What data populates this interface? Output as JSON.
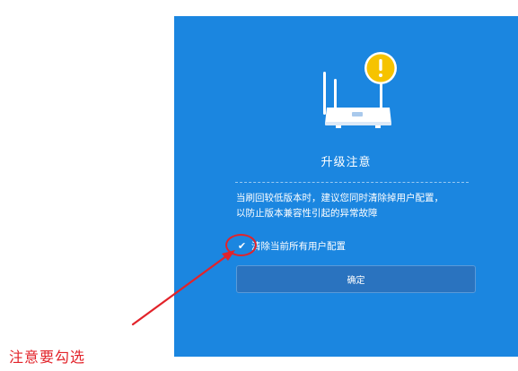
{
  "dialog": {
    "title": "升级注意",
    "message_line_1": "当刷回较低版本时，建议您同时清除掉用户配置，",
    "message_line_2": "以防止版本兼容性引起的异常故障",
    "checkbox": {
      "label": "清除当前所有用户配置",
      "checked": true,
      "check_glyph": "✔"
    },
    "confirm_label": "确定",
    "illustration": {
      "icon": "router-icon",
      "warning_icon": "warning-icon",
      "warning_glyph": "!"
    }
  },
  "annotation": {
    "note": "注意要勾选",
    "color": "#e2232a"
  },
  "colors": {
    "dialog_background": "#1b86e0",
    "button_background": "#2a73bf",
    "warning_yellow": "#f6c300"
  }
}
